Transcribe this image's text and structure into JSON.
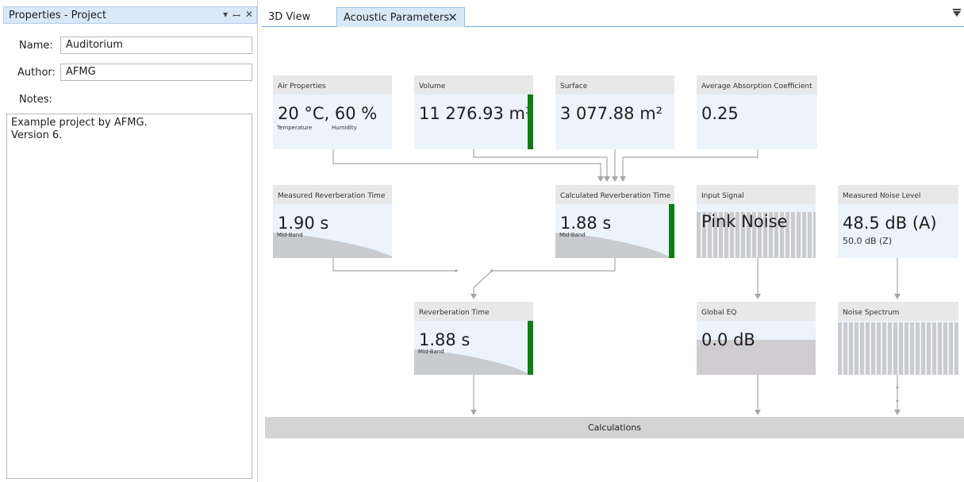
{
  "properties_pane": {
    "title": "Properties - Project",
    "icons": [
      "dropdown-arrow-icon",
      "pin-icon",
      "close-icon"
    ],
    "name_label": "Name:",
    "name_value": "Auditorium",
    "author_label": "Author:",
    "author_value": "AFMG",
    "notes_label": "Notes:",
    "notes_line1": "Example project by AFMG.",
    "notes_line2": "Version 6."
  },
  "tabs": [
    {
      "label": "3D View",
      "active": false
    },
    {
      "label": "Acoustic Parameters",
      "active": true,
      "close": "✕"
    }
  ],
  "blocks": {
    "air": {
      "title": "Air Properties",
      "value": "20 °C,  60 %",
      "sub1": "Temperature",
      "sub2": "Humidity"
    },
    "volume": {
      "title": "Volume",
      "value": "11 276.93 m³"
    },
    "surface": {
      "title": "Surface",
      "value": "3 077.88 m²"
    },
    "absorption": {
      "title": "Average Absorption Coefficient",
      "value": "0.25"
    },
    "measured_rt": {
      "title": "Measured Reverberation Time",
      "value": "1.90  s",
      "sub": "Mid-Band"
    },
    "calculated_rt": {
      "title": "Calculated Reverberation Time",
      "value": "1.88  s",
      "sub": "Mid-Band"
    },
    "input_signal": {
      "title": "Input Signal",
      "value": "Pink Noise"
    },
    "noise_level": {
      "title": "Measured Noise Level",
      "value": "48.5  dB (A)",
      "sub": "50.0  dB (Z)"
    },
    "rt": {
      "title": "Reverberation Time",
      "value": "1.88  s",
      "sub": "Mid-Band"
    },
    "global_eq": {
      "title": "Global EQ",
      "value": "0.0  dB"
    },
    "noise_spectrum": {
      "title": "Noise Spectrum"
    }
  },
  "calculations_label": "Calculations",
  "colors": {
    "accent_green": "#0f7d18",
    "block_bg": "#ecf3fb",
    "header_bg": "#e8e8e8",
    "tab_active": "#d9e8f7"
  }
}
